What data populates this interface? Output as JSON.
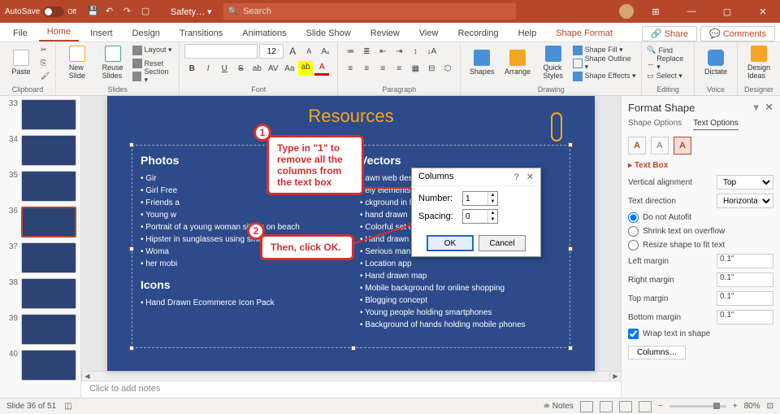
{
  "titlebar": {
    "autosave_label": "AutoSave",
    "autosave_state": "Off",
    "doc_title": "Safety… ▾",
    "search_placeholder": "Search"
  },
  "window_controls": {
    "min": "—",
    "max": "▢",
    "close": "✕",
    "ribbon_mode": "⊞"
  },
  "tabs": {
    "file": "File",
    "home": "Home",
    "insert": "Insert",
    "design": "Design",
    "transitions": "Transitions",
    "animations": "Animations",
    "slideshow": "Slide Show",
    "review": "Review",
    "view": "View",
    "recording": "Recording",
    "help": "Help",
    "shape_format": "Shape Format",
    "share": "Share",
    "comments": "Comments"
  },
  "ribbon": {
    "clipboard": {
      "paste": "Paste",
      "label": "Clipboard"
    },
    "slides": {
      "new_slide": "New\nSlide",
      "reuse": "Reuse\nSlides",
      "layout": "Layout ▾",
      "reset": "Reset",
      "section": "Section ▾",
      "label": "Slides"
    },
    "font": {
      "size": "12",
      "grow": "A",
      "shrink": "A",
      "clear": "Aₓ",
      "bold": "B",
      "italic": "I",
      "underline": "U",
      "strike": "S",
      "shadow": "ab",
      "spacing": "AV",
      "case": "Aa",
      "color_a": "A",
      "label": "Font"
    },
    "paragraph": {
      "label": "Paragraph"
    },
    "drawing": {
      "shapes": "Shapes",
      "arrange": "Arrange",
      "quick": "Quick\nStyles",
      "fill": "Shape Fill ▾",
      "outline": "Shape Outline ▾",
      "effects": "Shape Effects ▾",
      "label": "Drawing"
    },
    "editing": {
      "find": "Find",
      "replace": "Replace ▾",
      "select": "Select ▾",
      "label": "Editing"
    },
    "voice": {
      "dictate": "Dictate",
      "label": "Voice"
    },
    "designer": {
      "ideas": "Design\nIdeas",
      "label": "Designer"
    }
  },
  "thumbnails": [
    {
      "num": "33"
    },
    {
      "num": "34"
    },
    {
      "num": "35"
    },
    {
      "num": "36",
      "selected": true
    },
    {
      "num": "37"
    },
    {
      "num": "38"
    },
    {
      "num": "39"
    },
    {
      "num": "40"
    }
  ],
  "slide": {
    "title": "Resources",
    "left": {
      "h1": "Photos",
      "items1": [
        "Gir",
        "Girl Free",
        "Friends a",
        "Young w",
        "Portrait of a young woman sitting on beach",
        "Hipster in sunglasses using smartphone",
        "Woma",
        "her mobi"
      ],
      "h2": "Icons",
      "items2": [
        "Hand Drawn Ecommerce Icon Pack"
      ]
    },
    "right": {
      "h1": "Vectors",
      "items1": [
        "awn web design concept",
        "ely elements",
        "ckground in hand drawn",
        "hand drawn",
        "Colorful set of hand drawn infographics",
        "Hand drawn mobile phone, online payment",
        "Serious man wearing glasses",
        "Location app",
        "Hand drawn map",
        "Mobile background for online shopping",
        "Blogging concept",
        "Young people holding smartphones",
        "Background of hands holding mobile phones"
      ]
    }
  },
  "notes_placeholder": "Click to add notes",
  "callouts": {
    "badge1": "1",
    "text1": "Type in \"1\" to remove all the columns from the text box",
    "badge2": "2",
    "text2": "Then, click OK."
  },
  "dialog": {
    "title": "Columns",
    "help": "?",
    "close": "✕",
    "number_label": "Number:",
    "number_value": "1",
    "spacing_label": "Spacing:",
    "spacing_value": "0",
    "ok": "OK",
    "cancel": "Cancel"
  },
  "pane": {
    "title": "Format Shape",
    "shape_options": "Shape Options",
    "text_options": "Text Options",
    "icon_a1": "A",
    "icon_a2": "A",
    "icon_a3": "A",
    "section": "Text Box",
    "valign_label": "Vertical alignment",
    "valign_value": "Top",
    "dir_label": "Text direction",
    "dir_value": "Horizontal",
    "r_noautofit": "Do not Autofit",
    "r_shrink": "Shrink text on overflow",
    "r_resize": "Resize shape to fit text",
    "lm_label": "Left margin",
    "lm_value": "0.1\"",
    "rm_label": "Right margin",
    "rm_value": "0.1\"",
    "tm_label": "Top margin",
    "tm_value": "0.1\"",
    "bm_label": "Bottom margin",
    "bm_value": "0.1\"",
    "wrap": "Wrap text in shape",
    "columns_btn": "Columns…"
  },
  "status": {
    "slide": "Slide 36 of 51",
    "notes": "Notes",
    "zoom": "80%"
  }
}
